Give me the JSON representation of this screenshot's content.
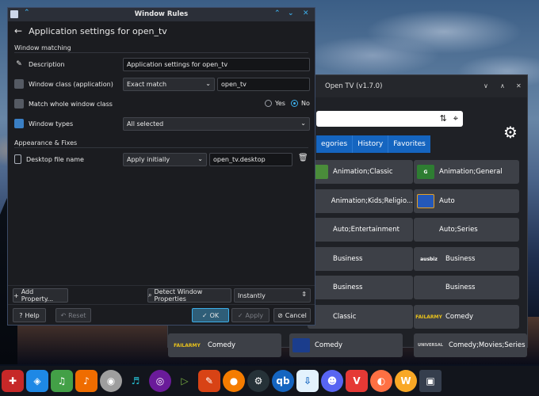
{
  "dialog": {
    "title": "Window Rules",
    "header_title": "Application settings for open_tv",
    "section_window_matching": "Window matching",
    "section_appearance": "Appearance & Fixes",
    "rows": {
      "description": {
        "label": "Description",
        "value": "Application settings for open_tv"
      },
      "window_class": {
        "label": "Window class (application)",
        "match": "Exact match",
        "value": "open_tv"
      },
      "match_whole": {
        "label": "Match whole window class",
        "yes": "Yes",
        "no": "No",
        "selected": "No"
      },
      "window_types": {
        "label": "Window types",
        "value": "All selected"
      },
      "desktop_file": {
        "label": "Desktop file name",
        "policy": "Apply initially",
        "value": "open_tv.desktop"
      }
    },
    "buttons": {
      "add_property": "Add Property...",
      "detect": "Detect Window Properties",
      "detect_delay": "Instantly",
      "help": "Help",
      "reset": "Reset",
      "ok": "OK",
      "apply": "Apply",
      "cancel": "Cancel"
    }
  },
  "opentv": {
    "title": "Open TV (v1.7.0)",
    "tabs": [
      "egories",
      "History",
      "Favorites"
    ],
    "channels_left": [
      "Animation;Classic",
      "Animation;Kids;Religio...",
      "Auto;Entertainment",
      "Business",
      "Business",
      "Classic",
      "Comedy"
    ],
    "channels_right": [
      "Animation;General",
      "Auto",
      "Auto;Series",
      "Business",
      "Business",
      "Comedy",
      "Comedy;Movies;Series"
    ],
    "logos": {
      "ausbiz": "ausbiz",
      "failarmy": "FAILARMY",
      "universal": "UNIVERSAL"
    }
  },
  "colors": {
    "accent": "#3daee9",
    "tab_blue": "#1565c0"
  }
}
